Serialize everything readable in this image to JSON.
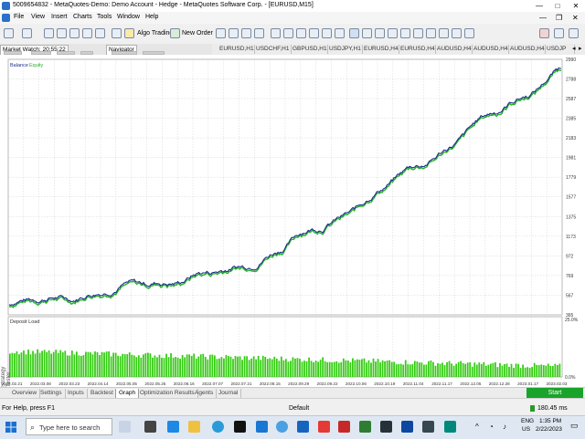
{
  "window": {
    "title": "5009654832 - MetaQuotes-Demo: Demo Account - Hedge - MetaQuotes Software Corp. - [EURUSD,M15]",
    "minimize": "—",
    "maximize": "□",
    "close": "✕"
  },
  "menu": [
    "File",
    "View",
    "Insert",
    "Charts",
    "Tools",
    "Window",
    "Help"
  ],
  "toolbar": {
    "algo_trading": "Algo Trading",
    "new_order": "New Order"
  },
  "panels": {
    "market_watch": "Market Watch: 20:55:22",
    "navigator": "Navigator"
  },
  "chart_tabs": [
    "EURUSD,H1",
    "USDCHF,H1",
    "GBPUSD,H1",
    "USDJPY,H1",
    "EURUSD,H4",
    "EURUSD,H4",
    "AUDUSD,H4",
    "AUDUSD,H4",
    "AUDUSD,H4",
    "USDJP"
  ],
  "chart_data": [
    {
      "type": "line",
      "legend": [
        "Balance",
        "Equity"
      ],
      "colors": {
        "balance": "#1a2f8a",
        "equity": "#27b12a"
      },
      "y_ticks": [
        "2990",
        "2788",
        "2587",
        "2385",
        "2183",
        "1981",
        "1779",
        "1577",
        "1375",
        "1173",
        "972",
        "769",
        "567",
        "365"
      ],
      "ylim": [
        365,
        2990
      ],
      "x": [
        "2022.02.21",
        "2022.03.31",
        "2022.06.15",
        "2022.09.29",
        "2022.12.27",
        "2023.02.21"
      ],
      "values": [
        470,
        650,
        820,
        1380,
        2120,
        2900
      ],
      "grid": true
    },
    {
      "type": "bar",
      "title": "Deposit Load",
      "y_ticks": [
        "25.0%",
        "0.0%"
      ],
      "ylim": [
        0,
        25
      ],
      "bar_color": "#33cc11",
      "values_start": 11.0,
      "values_end": 4.5,
      "bar_count": 240,
      "grid": true
    }
  ],
  "x_axis_ticks": [
    "2022.02.21",
    "2022.03.08",
    "2022.03.23",
    "2022.04.14",
    "2022.05.05",
    "2022.05.25",
    "2022.06.16",
    "2022.07.07",
    "2022.07.21",
    "2022.08.15",
    "2022.09.29",
    "2022.09.22",
    "2022.10.06",
    "2022.10.19",
    "2022.11.04",
    "2022.11.17",
    "2022.12.05",
    "2022.12.28",
    "2023.01.17",
    "2023.02.03"
  ],
  "bottom_tabs": [
    "Overview",
    "Settings",
    "Inputs",
    "Backtest",
    "Graph",
    "Optimization Results",
    "Agents",
    "Journal"
  ],
  "active_bottom_tab": "Graph",
  "side_label": "Strategy Tester",
  "start_button": "Start",
  "status": {
    "help": "For Help, press F1",
    "profile": "Default",
    "traffic": "180.45 ms"
  },
  "taskbar": {
    "search_placeholder": "Type here to search",
    "lang1": "ENG",
    "lang2": "US",
    "time": "1:35 PM",
    "date": "2/22/2023"
  }
}
